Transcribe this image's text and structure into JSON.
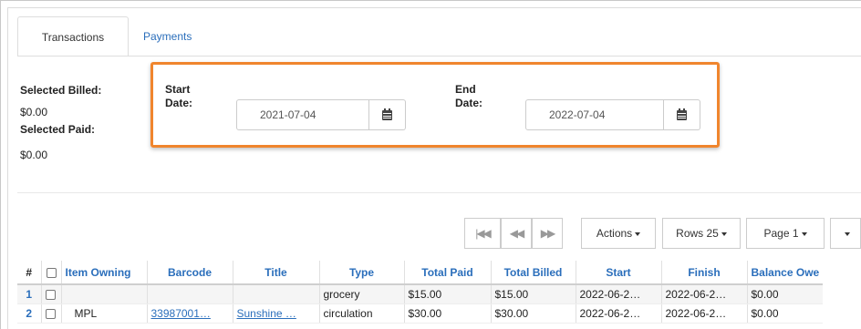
{
  "tabs": [
    {
      "label": "Transactions",
      "active": true
    },
    {
      "label": "Payments",
      "active": false
    }
  ],
  "summary": {
    "selected_billed_label": "Selected Billed:",
    "selected_billed_value": "$0.00",
    "selected_paid_label": "Selected Paid:",
    "selected_paid_value": "$0.00"
  },
  "date_filter": {
    "start_label_line1": "Start",
    "start_label_line2": "Date:",
    "start_value": "2021-07-04",
    "end_label_line1": "End",
    "end_label_line2": "Date:",
    "end_value": "2022-07-04",
    "highlight_color": "#f0852d",
    "icon": "calendar-icon"
  },
  "pager": {
    "first_icon": "first-page-icon",
    "prev_icon": "previous-page-icon",
    "next_icon": "next-page-icon",
    "actions_label": "Actions",
    "rows_label": "Rows 25",
    "page_label": "Page 1"
  },
  "grid": {
    "columns": [
      "#",
      "",
      "Item Owning",
      "Barcode",
      "Title",
      "Type",
      "Total Paid",
      "Total Billed",
      "Start",
      "Finish",
      "Balance Owe"
    ],
    "rows": [
      {
        "index": "1",
        "item_owning": "",
        "barcode": "",
        "title": "",
        "type": "grocery",
        "total_paid": "$15.00",
        "total_billed": "$15.00",
        "start": "2022-06-2…",
        "finish": "2022-06-2…",
        "balance": "$0.00"
      },
      {
        "index": "2",
        "item_owning": "MPL",
        "barcode": "33987001…",
        "title": "Sunshine …",
        "type": "circulation",
        "total_paid": "$30.00",
        "total_billed": "$30.00",
        "start": "2022-06-2…",
        "finish": "2022-06-2…",
        "balance": "$0.00"
      }
    ]
  },
  "colors": {
    "link": "#2a6ebb",
    "highlight": "#f0852d"
  }
}
